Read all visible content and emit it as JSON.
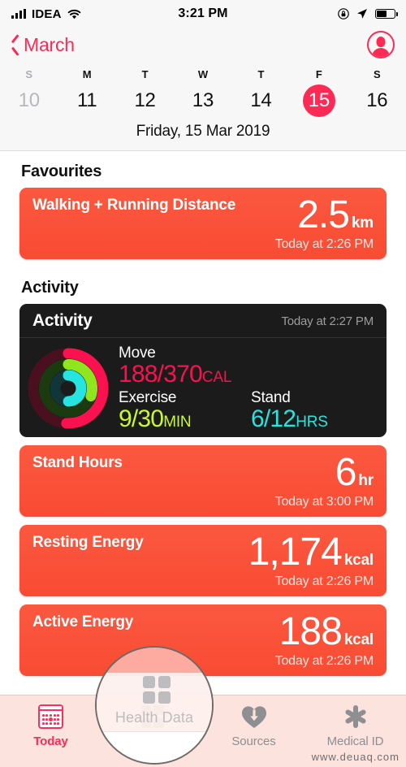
{
  "status_bar": {
    "carrier": "IDEA",
    "time": "3:21 PM",
    "wifi_icon": "wifi-icon",
    "signal_icon": "cellular-signal-icon",
    "rotation_lock_icon": "rotation-lock-icon",
    "location_icon": "location-arrow-icon",
    "battery_icon": "battery-icon"
  },
  "nav": {
    "back_label": "March",
    "back_icon": "chevron-left-icon",
    "avatar_icon": "profile-avatar-icon",
    "accent_color": "#FC2A55"
  },
  "calendar": {
    "day_initials": [
      "S",
      "M",
      "T",
      "W",
      "T",
      "F",
      "S"
    ],
    "dates": [
      "10",
      "11",
      "12",
      "13",
      "14",
      "15",
      "16"
    ],
    "selected_date": "15",
    "dimmed_dates": [
      "10"
    ],
    "full_date": "Friday, 15 Mar 2019"
  },
  "sections": [
    {
      "title": "Favourites"
    },
    {
      "title": "Activity"
    }
  ],
  "favourites": [
    {
      "title": "Walking + Running Distance",
      "value": "2.5",
      "unit": "km",
      "stamp": "Today at 2:26 PM"
    }
  ],
  "activity_card": {
    "title": "Activity",
    "stamp": "Today at 2:27 PM",
    "rings_icon": "activity-rings-icon",
    "move": {
      "label": "Move",
      "value": "188/370",
      "unit": "CAL",
      "color": "#FA114F",
      "progress": 0.51
    },
    "exercise": {
      "label": "Exercise",
      "value": "9/30",
      "unit": "MIN",
      "color": "#C9F92A",
      "progress": 0.3
    },
    "stand": {
      "label": "Stand",
      "value": "6/12",
      "unit": "HRS",
      "color": "#26E5E0",
      "progress": 0.5
    }
  },
  "activity_cards": [
    {
      "title": "Stand Hours",
      "value": "6",
      "unit": "hr",
      "stamp": "Today at 3:00 PM"
    },
    {
      "title": "Resting Energy",
      "value": "1,174",
      "unit": "kcal",
      "stamp": "Today at 2:26 PM"
    },
    {
      "title": "Active Energy",
      "value": "188",
      "unit": "kcal",
      "stamp": "Today at 2:26 PM"
    }
  ],
  "tab_bar": {
    "tabs": [
      {
        "label": "Today",
        "icon": "calendar-icon",
        "active": true
      },
      {
        "label": "Health Data",
        "icon": "grid-squares-icon",
        "active": false
      },
      {
        "label": "Sources",
        "icon": "heart-download-icon",
        "active": false
      },
      {
        "label": "Medical ID",
        "icon": "asterisk-icon",
        "active": false
      }
    ],
    "active_color": "#FC2A55",
    "inactive_color": "#8E8E93",
    "background_color": "#FCE3DE"
  },
  "loupe": {
    "magnified_label": "Health Data",
    "icon": "grid-squares-icon"
  },
  "watermark": {
    "text": "www.deuaq.com"
  },
  "card_color": "#FA5038"
}
